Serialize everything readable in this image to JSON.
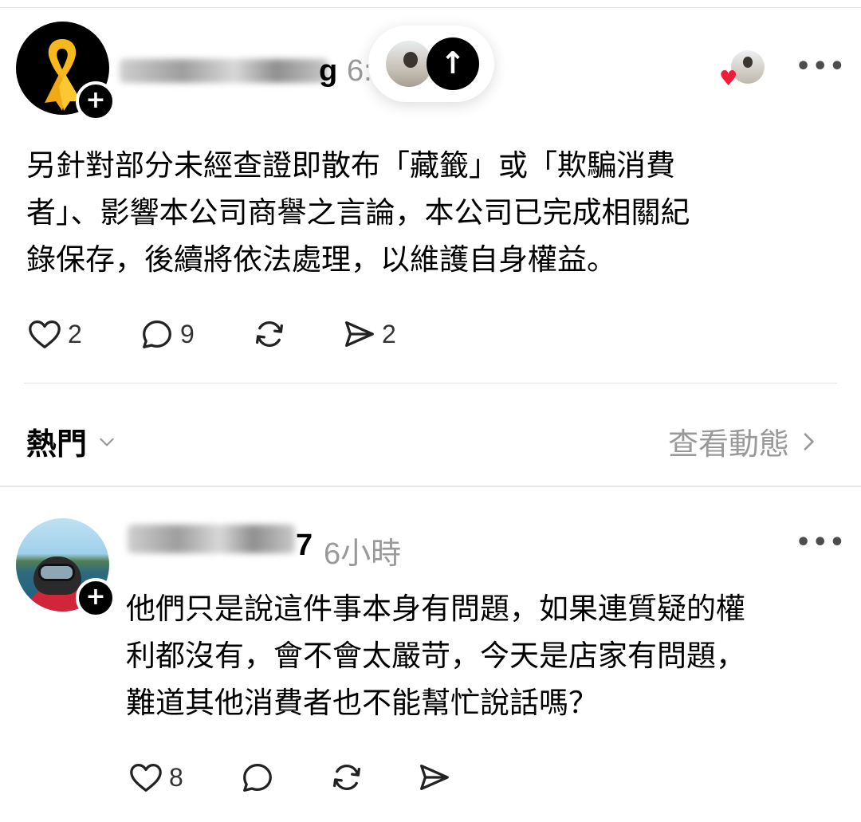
{
  "post": {
    "username_tail": "g",
    "time": "6:",
    "body": "另針對部分未經查證即散布「藏籤」或「欺騙消費\n者」、影響本公司商譽之言論，本公司已完成相關紀\n錄保存，後續將依法處理，以維護自身權益。",
    "likes": "2",
    "comments": "9",
    "shares": "2",
    "more": "•••"
  },
  "floating": {
    "up_arrow": "↑"
  },
  "sort": {
    "label": "熱門",
    "view_activity": "查看動態"
  },
  "reply": {
    "username_tail": "7",
    "time": "6小時",
    "body": "他們只是說這件事本身有問題，如果連質疑的權\n利都沒有，會不會太嚴苛，今天是店家有問題，\n難道其他消費者也不能幫忙說話嗎？",
    "likes": "8",
    "more": "•••"
  },
  "icons": {
    "follow": "plus-icon",
    "like": "heart-icon",
    "comment": "comment-icon",
    "repost": "repost-icon",
    "share": "send-icon"
  },
  "colors": {
    "accent_heart": "#ee1d3a",
    "ribbon": "#f7b81c",
    "muted": "#999999"
  }
}
